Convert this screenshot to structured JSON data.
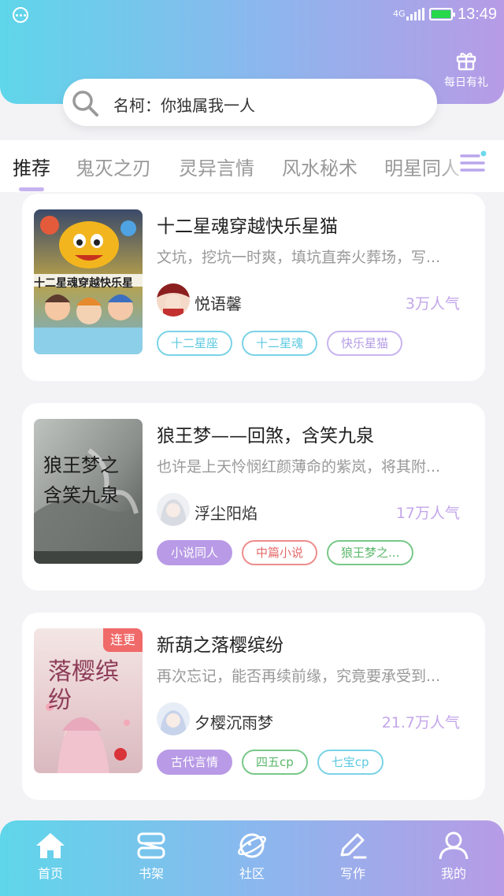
{
  "status_bar": {
    "network": "4G",
    "time": "13:49"
  },
  "header": {
    "gift_label": "每日有礼",
    "search_text": "名柯：你独属我一人"
  },
  "tabs": [
    {
      "label": "推荐",
      "active": true
    },
    {
      "label": "鬼灭之刃",
      "active": false
    },
    {
      "label": "灵异言情",
      "active": false
    },
    {
      "label": "风水秘术",
      "active": false
    },
    {
      "label": "明星同人",
      "active": false
    }
  ],
  "books": [
    {
      "title": "十二星魂穿越快乐星猫",
      "description": "文坑，挖坑一时爽，填坑直奔火葬场，写...",
      "author": "悦语馨",
      "popularity": "3万人气",
      "cover_text": "十二星魂穿越快乐星",
      "badge": "",
      "tags": [
        {
          "label": "十二星座",
          "style": "t-cyan"
        },
        {
          "label": "十二星魂",
          "style": "t-cyan"
        },
        {
          "label": "快乐星猫",
          "style": "t-purple"
        }
      ]
    },
    {
      "title": "狼王梦——回煞，含笑九泉",
      "description": "也许是上天怜悯红颜薄命的紫岚，将其附...",
      "author": "浮尘阳焰",
      "popularity": "17万人气",
      "cover_text": "狼王梦之含笑九泉",
      "badge": "",
      "tags": [
        {
          "label": "小说同人",
          "style": "t-fill"
        },
        {
          "label": "中篇小说",
          "style": "t-red"
        },
        {
          "label": "狼王梦之...",
          "style": "t-green"
        }
      ]
    },
    {
      "title": "新葫之落樱缤纷",
      "description": "再次忘记，能否再续前缘，究竟要承受到...",
      "author": "夕樱沉雨梦",
      "popularity": "21.7万人气",
      "cover_text": "落樱缤纷",
      "badge": "连更",
      "tags": [
        {
          "label": "古代言情",
          "style": "t-fill"
        },
        {
          "label": "四五cp",
          "style": "t-green"
        },
        {
          "label": "七宝cp",
          "style": "t-cyan"
        }
      ]
    }
  ],
  "bottom_nav": [
    {
      "label": "首页",
      "icon": "home-icon"
    },
    {
      "label": "书架",
      "icon": "bookshelf-icon"
    },
    {
      "label": "社区",
      "icon": "planet-icon"
    },
    {
      "label": "写作",
      "icon": "pen-icon"
    },
    {
      "label": "我的",
      "icon": "user-icon"
    }
  ],
  "colors": {
    "gradient_start": "#5fd6ea",
    "gradient_end": "#b79be6",
    "popularity": "#c3a6ea",
    "badge": "#f06a6a"
  }
}
